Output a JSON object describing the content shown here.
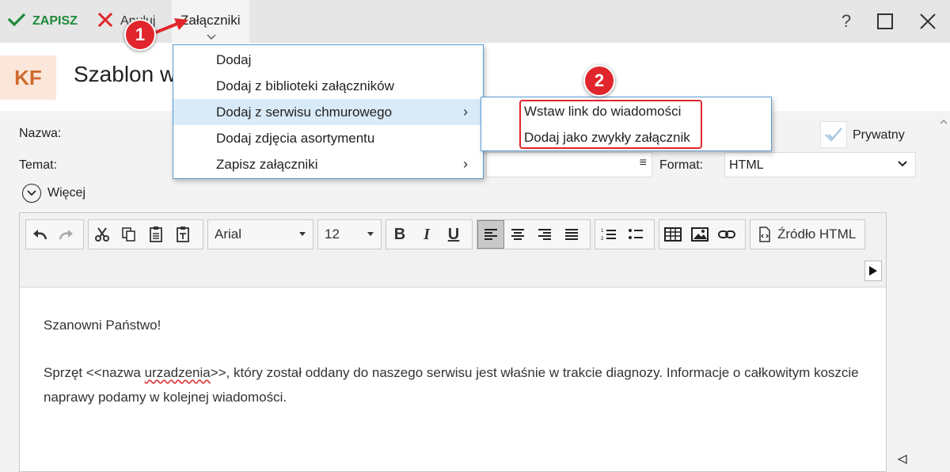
{
  "toolbar": {
    "save_label": "ZAPISZ",
    "cancel_label": "Anuluj",
    "attachments_label": "Załączniki",
    "help_label": "?"
  },
  "header": {
    "avatar_initials": "KF",
    "title": "Szablon w"
  },
  "form": {
    "name_label": "Nazwa:",
    "subject_label": "Temat:",
    "private_label": "Prywatny",
    "private_checked": true,
    "format_label": "Format:",
    "format_value": "HTML",
    "more_label": "Więcej"
  },
  "editor": {
    "font_name": "Arial",
    "font_size": "12",
    "source_label": "Źródło HTML",
    "bold": "B",
    "italic": "I",
    "underline": "U",
    "greeting": "Szanowni Państwo!",
    "body_before": "Sprzęt <<nazwa ",
    "body_misspelled": "urzadzenia",
    "body_after": ">>, który został oddany do naszego serwisu jest właśnie w trakcie diagnozy. Informacje o całkowitym koszcie naprawy podamy w kolejnej wiadomości."
  },
  "menu": {
    "items": [
      {
        "label": "Dodaj"
      },
      {
        "label": "Dodaj z biblioteki załączników"
      },
      {
        "label": "Dodaj z serwisu chmurowego",
        "has_submenu": true,
        "highlighted": true
      },
      {
        "label": "Dodaj zdjęcia asortymentu"
      },
      {
        "label": "Zapisz załączniki",
        "has_submenu": true
      }
    ],
    "submenu_items": [
      {
        "label": "Wstaw link do wiadomości"
      },
      {
        "label": "Dodaj jako zwykły załącznik"
      }
    ],
    "submenu_arrow": "›"
  },
  "annotations": {
    "badge1": "1",
    "badge2": "2"
  },
  "colors": {
    "save_green": "#1d8a3a",
    "cancel_red": "#e0262c",
    "highlight_blue": "#d9ebf9",
    "menu_border": "#5b9bd5",
    "avatar_orange": "#d06a2f"
  }
}
